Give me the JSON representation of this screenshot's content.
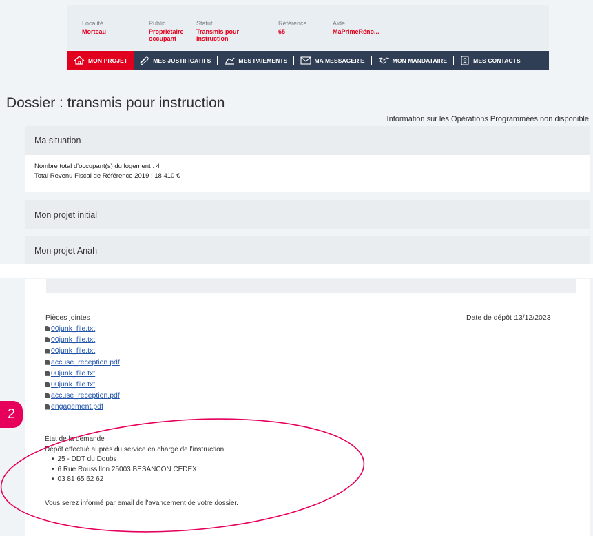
{
  "info": {
    "localite": {
      "label": "Localité",
      "value": "Morteau"
    },
    "public": {
      "label": "Public",
      "value_line1": "Propriétaire",
      "value_line2": "occupant"
    },
    "statut": {
      "label": "Statut",
      "value_line1": "Transmis pour",
      "value_line2": "instruction"
    },
    "reference": {
      "label": "Référence",
      "value": "65"
    },
    "aide": {
      "label": "Aide",
      "value": "MaPrimeRéno..."
    }
  },
  "nav": [
    {
      "label": "MON PROJET",
      "icon": "house-icon",
      "active": true
    },
    {
      "label": "MES JUSTIFICATIFS",
      "icon": "paperclip-icon"
    },
    {
      "label": "MES PAIEMENTS",
      "icon": "payment-icon"
    },
    {
      "label": "MA MESSAGERIE",
      "icon": "envelope-icon"
    },
    {
      "label": "MON MANDATAIRE",
      "icon": "handshake-icon"
    },
    {
      "label": "MES CONTACTS",
      "icon": "contacts-icon"
    }
  ],
  "page_title": "Dossier : transmis pour instruction",
  "op_info": "Information sur les Opérations Programmées non disponible",
  "sections": {
    "situation": "Ma situation",
    "projet_initial": "Mon projet initial",
    "projet_anah": "Mon projet Anah"
  },
  "situation": {
    "occupants": "Nombre total d'occupant(s) du logement : 4",
    "revenu": "Total Revenu Fiscal de Référence 2019 : 18 410 €"
  },
  "attachments": {
    "title": "Pièces jointes",
    "files": [
      "00junk_file.txt",
      "00junk_file.txt",
      "00junk_file.txt",
      "accuse_reception.pdf",
      "00junk_file.txt",
      "00junk_file.txt",
      "accuse_reception.pdf",
      "engagement.pdf"
    ],
    "date_label": "Date de dépôt :",
    "date_value": "13/12/2023"
  },
  "state": {
    "title": "État de la demande",
    "intro": "Dépôt effectué auprès du service en charge de l'instruction :",
    "items": [
      "25 - DDT du Doubs",
      "6 Rue Roussillon 25003 BESANCON CEDEX",
      "03 81 65 62 62"
    ],
    "note": "Vous serez informé par email de l'avancement de votre dossier."
  },
  "annotation_number": "2",
  "colors": {
    "accent": "#e1001d",
    "nav_bg": "#2f3e54",
    "annotation": "#e6005c"
  }
}
